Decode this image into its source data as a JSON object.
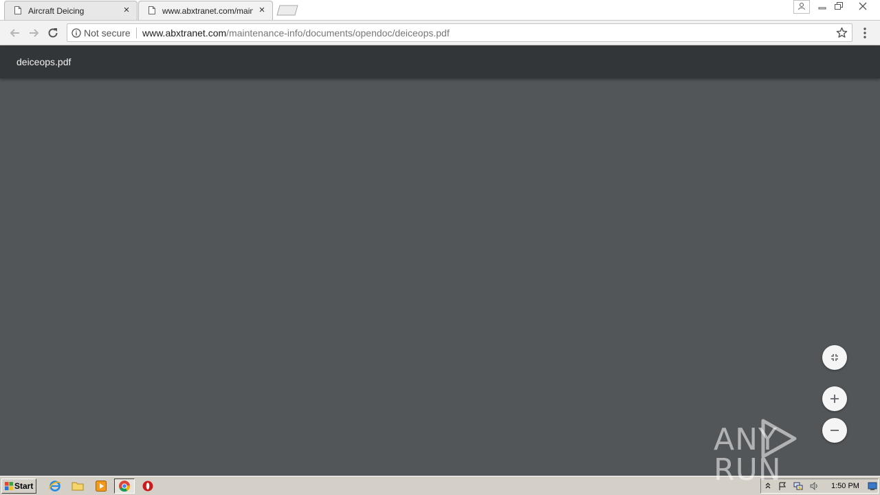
{
  "tabs": [
    {
      "title": "Aircraft Deicing",
      "close": "×",
      "active": false
    },
    {
      "title": "www.abxtranet.com/mainte",
      "close": "×",
      "active": true
    }
  ],
  "window_controls": {
    "user": "person-icon",
    "minimize": "—",
    "restore": "❐",
    "close": "✕"
  },
  "toolbar": {
    "security_label": "Not secure",
    "url_host": "www.abxtranet.com",
    "url_path": "/maintenance-info/documents/opendoc/deiceops.pdf"
  },
  "pdf": {
    "title": "deiceops.pdf",
    "buttons": [
      "fit-to-page-icon",
      "zoom-in-icon",
      "zoom-out-icon"
    ]
  },
  "watermark": {
    "text": "ANY  RUN"
  },
  "taskbar": {
    "start_label": "Start",
    "apps": [
      "internet-explorer-icon",
      "folder-icon",
      "media-player-icon",
      "chrome-icon",
      "opera-icon"
    ],
    "clock": "1:50 PM"
  },
  "colors": {
    "pdf_header": "#323639",
    "pdf_body": "#525659",
    "taskbar": "#d4d0c8"
  }
}
